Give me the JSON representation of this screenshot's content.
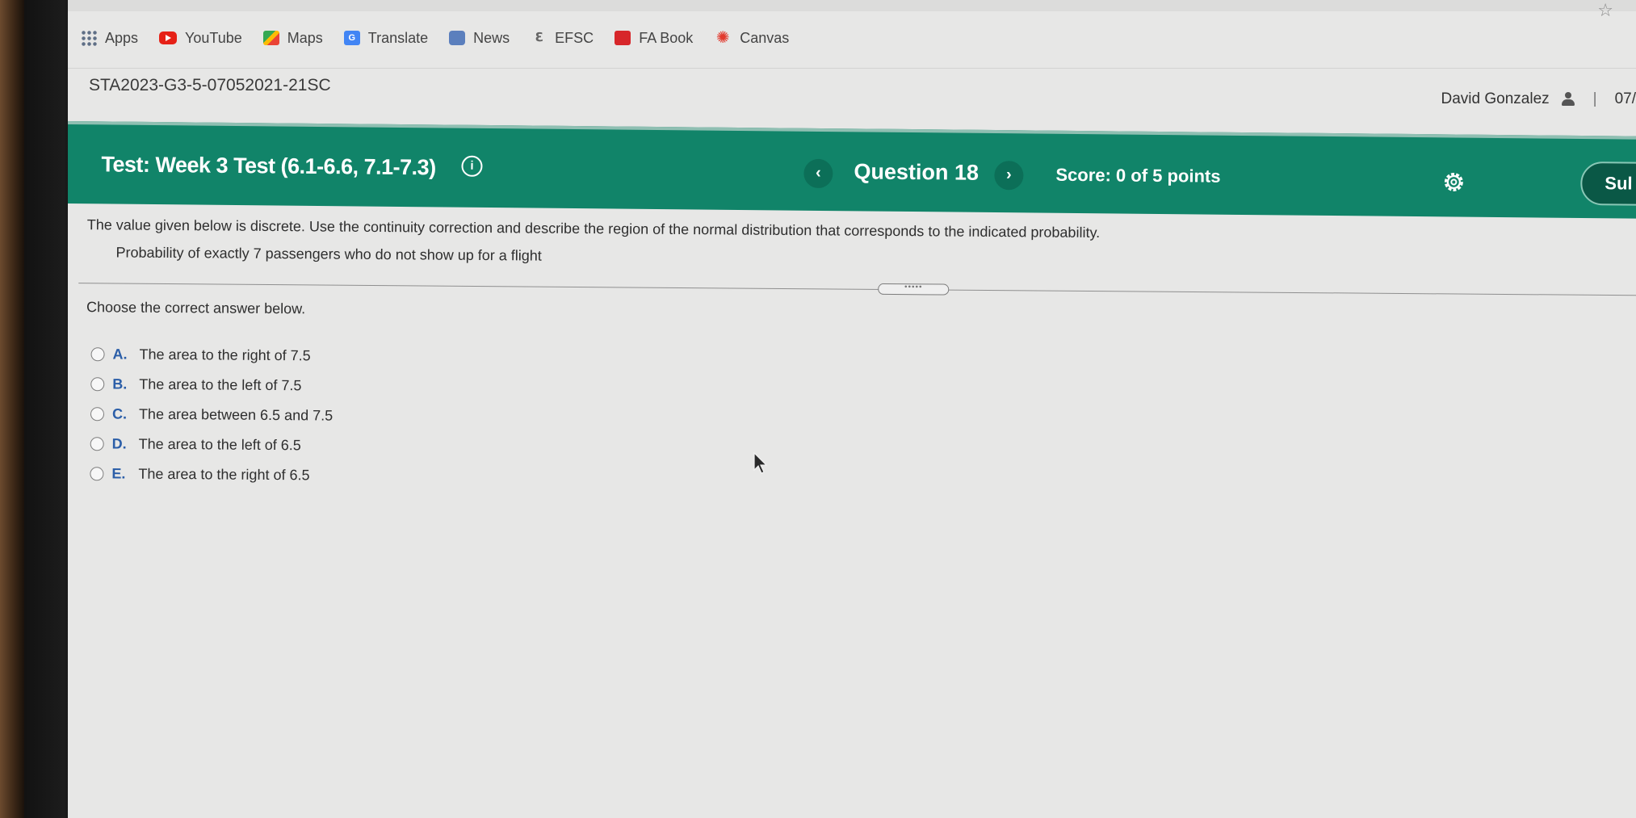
{
  "bookmarks": [
    {
      "label": "Apps",
      "icon": "apps-grid-icon"
    },
    {
      "label": "YouTube",
      "icon": "youtube-icon"
    },
    {
      "label": "Maps",
      "icon": "maps-icon"
    },
    {
      "label": "Translate",
      "icon": "translate-icon"
    },
    {
      "label": "News",
      "icon": "news-icon"
    },
    {
      "label": "EFSC",
      "icon": "efsc-icon"
    },
    {
      "label": "FA Book",
      "icon": "fa-book-icon"
    },
    {
      "label": "Canvas",
      "icon": "canvas-icon"
    }
  ],
  "course": {
    "title": "STA2023-G3-5-07052021-21SC",
    "user_name": "David Gonzalez",
    "date_partial": "07/"
  },
  "test_bar": {
    "title": "Test: Week 3 Test (6.1-6.6, 7.1-7.3)",
    "prev_symbol": "‹",
    "next_symbol": "›",
    "question_label": "Question 18",
    "score": "Score: 0 of 5 points",
    "submit_label": "Sul",
    "accent_color": "#118469"
  },
  "question": {
    "prompt": "The value given below is discrete. Use the continuity correction and describe the region of the normal distribution that corresponds to the indicated probability.",
    "sub_prompt": "Probability of exactly 7 passengers who do not show up for a flight",
    "instruction": "Choose the correct answer below.",
    "options": [
      {
        "letter": "A.",
        "text": "The area to the right of 7.5"
      },
      {
        "letter": "B.",
        "text": "The area to the left of 7.5"
      },
      {
        "letter": "C.",
        "text": "The area between 6.5 and 7.5"
      },
      {
        "letter": "D.",
        "text": "The area to the left of 6.5"
      },
      {
        "letter": "E.",
        "text": "The area to the right of 6.5"
      }
    ]
  }
}
